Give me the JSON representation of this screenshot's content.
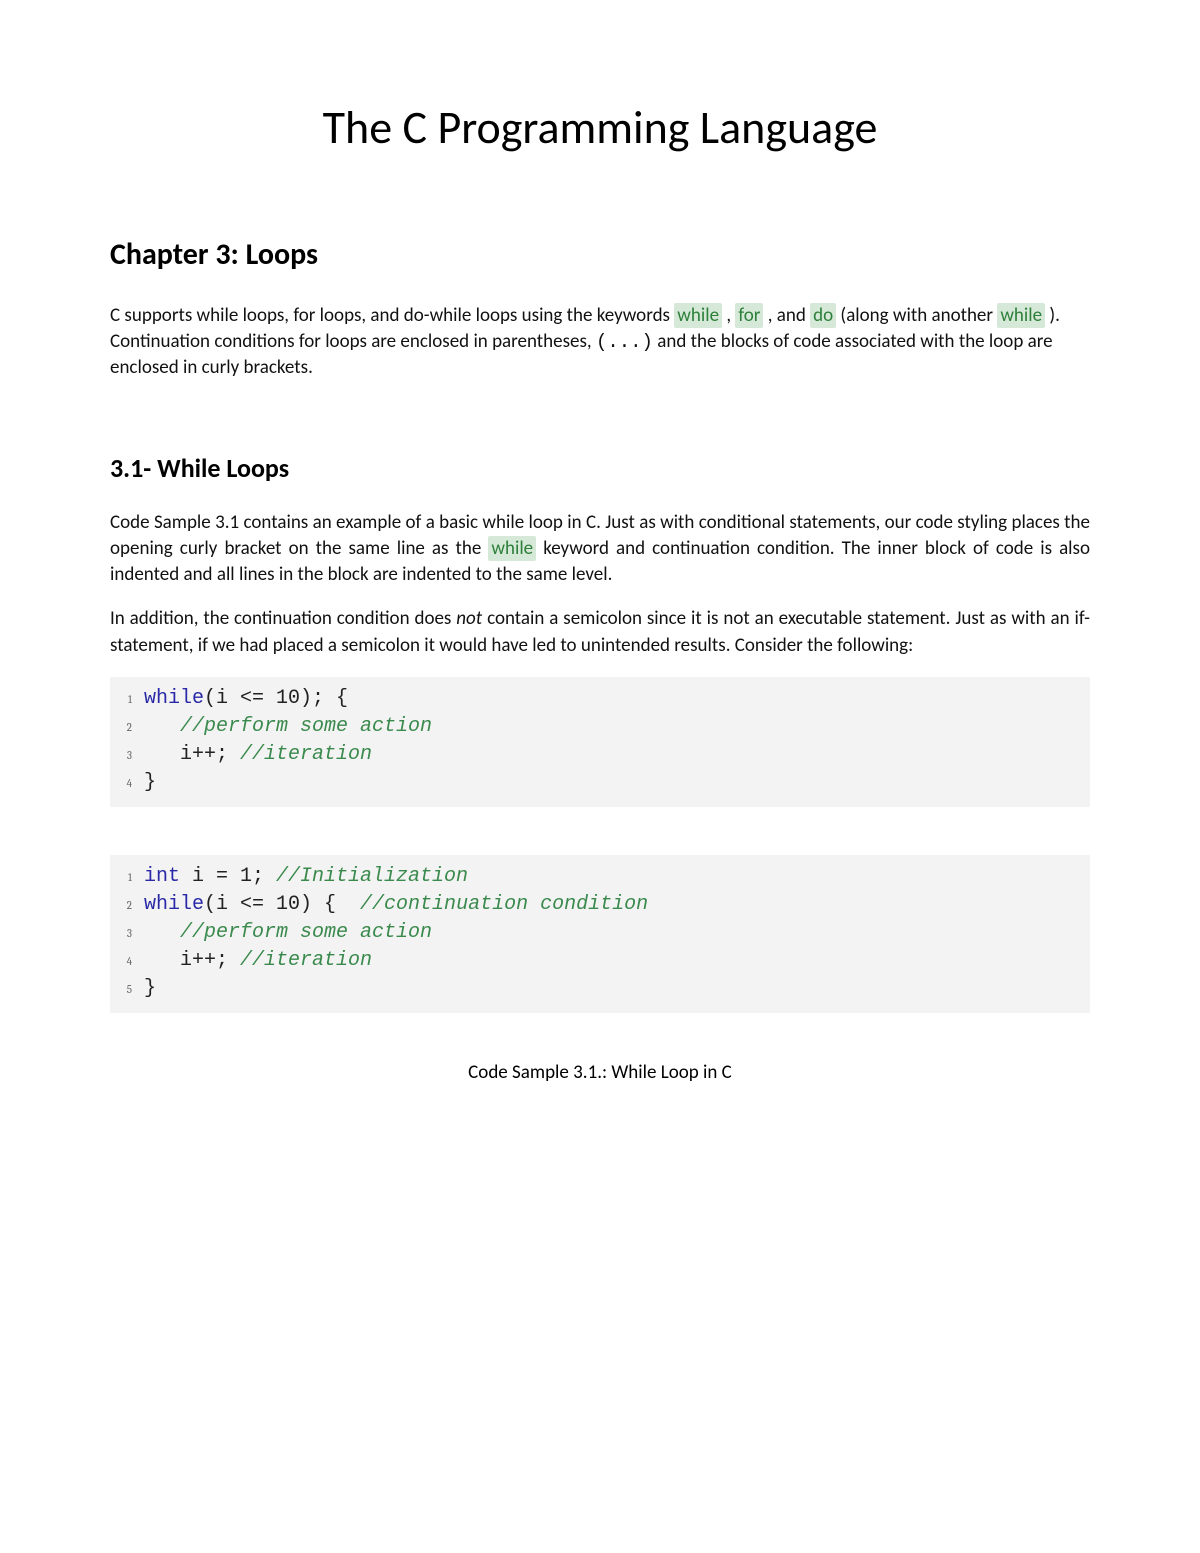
{
  "title": "The C Programming Language",
  "chapter": "Chapter 3: Loops",
  "intro": {
    "p1a": "C supports while loops, for loops, and do-while loops using the keywords ",
    "kw_while": "while",
    "p1b": " , ",
    "kw_for": "for",
    "p1c": " , and ",
    "kw_do": "do",
    "p1d": " (along with another ",
    "kw_while2": "while",
    "p1e": " ). Continuation conditions for loops are enclosed in parentheses, ",
    "paren": "(...)",
    "p1f": " and the blocks of code associated with the loop are enclosed in curly brackets."
  },
  "section31": "3.1- While Loops",
  "s31": {
    "p1a": "Code Sample 3.1 contains an example of a basic while loop in C. Just as with conditional statements, our code styling places the opening curly bracket on the same line as the ",
    "kw_while": "while",
    "p1b": " keyword and continuation condition. The inner block of code is also indented and all lines in the block are indented to the same level.",
    "p2a": "In addition, the continuation condition does ",
    "not": "not",
    "p2b": " contain a semicolon since it is not an executable statement. Just as with an if-statement, if we had placed a semicolon it would have led to unintended results. Consider the following:"
  },
  "code1": {
    "l1": {
      "n": "1",
      "kw": "while",
      "rest": "(i <= 10); {"
    },
    "l2": {
      "n": "2",
      "cm": "//perform some action"
    },
    "l3": {
      "n": "3",
      "txt": "i++; ",
      "cm": "//iteration"
    },
    "l4": {
      "n": "4",
      "txt": "}"
    }
  },
  "code2": {
    "l1": {
      "n": "1",
      "type": "int",
      "txt": " i = 1; ",
      "cm": "//Initialization"
    },
    "l2": {
      "n": "2",
      "kw": "while",
      "rest": "(i <= 10) {  ",
      "cm": "//continuation condition"
    },
    "l3": {
      "n": "3",
      "cm": "//perform some action"
    },
    "l4": {
      "n": "4",
      "txt": "i++; ",
      "cm": "//iteration"
    },
    "l5": {
      "n": "5",
      "txt": "}"
    }
  },
  "caption": "Code Sample 3.1.: While Loop in C"
}
